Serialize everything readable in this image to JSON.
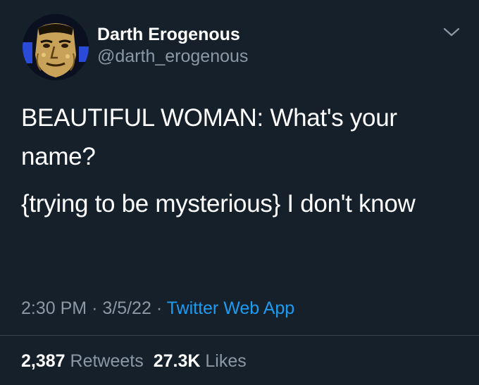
{
  "author": {
    "display_name": "Darth Erogenous",
    "handle": "@darth_erogenous",
    "avatar_icon": "posterized-portrait-avatar"
  },
  "menu_icon": "chevron-down-icon",
  "tweet": {
    "paragraphs": [
      "BEAUTIFUL WOMAN: What's your name?",
      "{trying to be mysterious} I don't know"
    ]
  },
  "meta": {
    "time": "2:30 PM",
    "separator": "·",
    "date": "3/5/22",
    "source": "Twitter Web App"
  },
  "stats": {
    "retweets_count": "2,387",
    "retweets_label": "Retweets",
    "likes_count": "27.3K",
    "likes_label": "Likes"
  },
  "colors": {
    "background": "#15202b",
    "primary_text": "#ffffff",
    "secondary_text": "#8b98a5",
    "link": "#1d9bf0",
    "divider": "#38444d"
  }
}
